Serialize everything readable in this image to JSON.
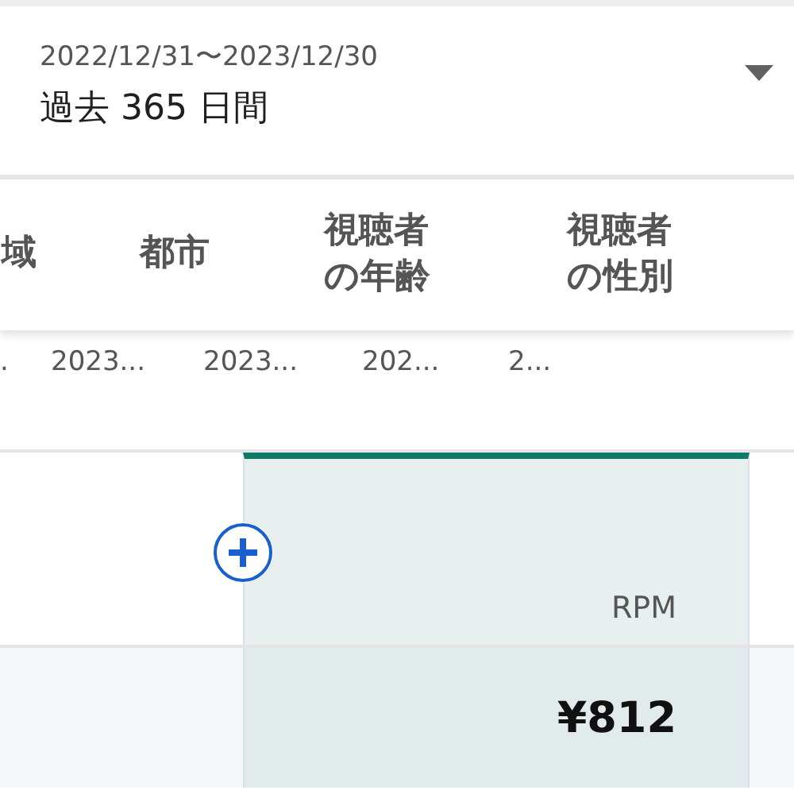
{
  "date_range": {
    "dates": "2022/12/31〜2023/12/30",
    "label": "過去 365 日間"
  },
  "tabs": [
    "域",
    "都市",
    "視聴者の年齢",
    "視聴者の性別"
  ],
  "tab_values": [
    ".",
    "2023...",
    "2023...",
    "202...",
    "2..."
  ],
  "table": {
    "columns": [
      {
        "label": "RPM",
        "selected": true
      }
    ],
    "rows": [
      {
        "cells": [
          "¥812"
        ]
      }
    ]
  }
}
